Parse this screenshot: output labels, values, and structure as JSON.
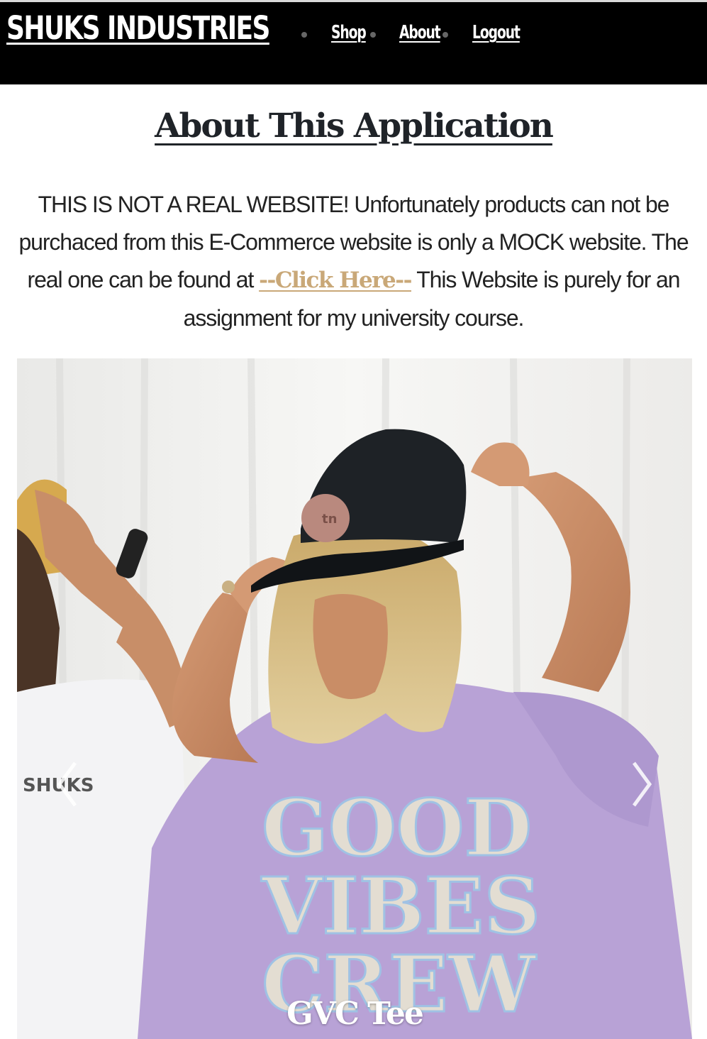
{
  "nav": {
    "brand": "SHUKS INDUSTRIES",
    "links": [
      {
        "label": "Shop"
      },
      {
        "label": "About"
      },
      {
        "label": "Logout"
      }
    ]
  },
  "main": {
    "title": "About This Application",
    "description_before": "THIS IS NOT A REAL WEBSITE! Unfortunately products can not be purchaced from this E-Commerce website is only a MOCK website. The real one can be found at ",
    "link_label": "--Click Here--",
    "description_after": " This Website is purely for an assignment for my university course."
  },
  "carousel": {
    "slide_caption": "GVC Tee",
    "shirt_text": "GOOD VIBES CREW",
    "back_shirt_text": "SHUKS",
    "prev_icon": "chevron-left-icon",
    "next_icon": "chevron-right-icon"
  },
  "colors": {
    "navbar_bg": "#000000",
    "link_accent": "#c9a878",
    "title_text": "#1f2328"
  }
}
